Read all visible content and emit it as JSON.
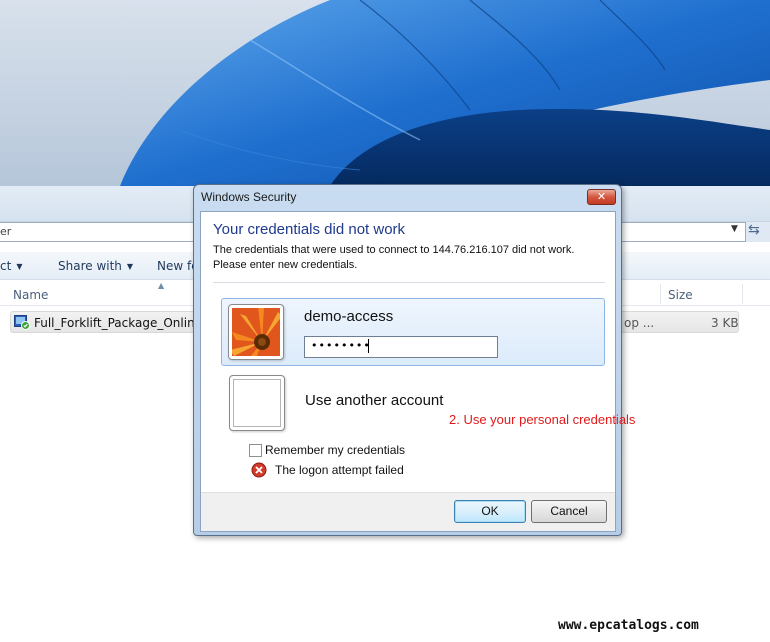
{
  "explorer": {
    "address_text": "er",
    "toolbar": {
      "organize_label": "ct",
      "share_label": "Share with",
      "new_folder_label": "New fo"
    },
    "columns": {
      "name_label": "Name",
      "size_label": "Size"
    },
    "file": {
      "name": "Full_Forklift_Package_Online.rdp",
      "type": "op ...",
      "size": "3 KB"
    }
  },
  "dialog": {
    "title": "Windows Security",
    "close_glyph": "✕",
    "heading": "Your credentials did not work",
    "description_line1": "The credentials that were used to connect to 144.76.216.107 did not work.",
    "description_line2": "Please enter new credentials.",
    "account": {
      "username": "demo-access",
      "password_masked": "••••••••"
    },
    "other_account_label": "Use another account",
    "annotation": "2. Use your personal credentials",
    "remember_label": "Remember my credentials",
    "remember_checked": false,
    "error_text": "The logon attempt failed",
    "ok_label": "OK",
    "cancel_label": "Cancel"
  },
  "watermark": "www.epcatalogs.com",
  "icons": {
    "close": "close-icon",
    "error": "error-icon",
    "file": "rdp-file-icon",
    "refresh": "refresh-icon",
    "dropdown": "chevron-down-icon"
  },
  "colors": {
    "heading_blue": "#1e3a8c",
    "annotation_red": "#e01b1b",
    "selected_tile": "#dcebfb",
    "close_button": "#d4573f"
  }
}
